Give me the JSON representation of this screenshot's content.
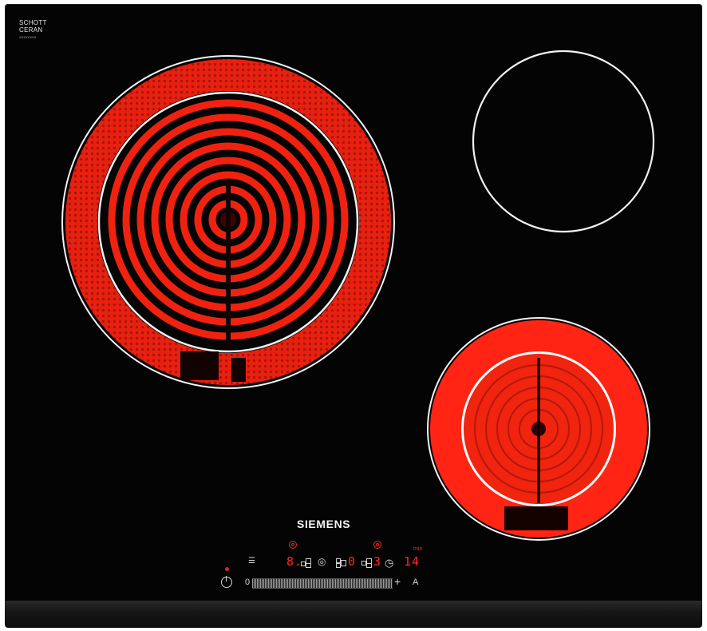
{
  "brand_mark": {
    "line1": "SCHOTT",
    "line2": "CERAN",
    "line3": "XXXXXXXX"
  },
  "brand": "SIEMENS",
  "zones": [
    {
      "id": "front-left",
      "state": "glowing",
      "rings": 2
    },
    {
      "id": "rear-right",
      "state": "off"
    },
    {
      "id": "front-right",
      "state": "glowing",
      "rings": 2
    }
  ],
  "controls": {
    "power_icon": "power-icon",
    "slider_min": "0",
    "slider_max": "+",
    "auto_label": "A",
    "display_left": "8.",
    "display_mid": "0",
    "display_zone": "3",
    "timer_value": "14",
    "timer_unit": "min"
  },
  "colors": {
    "glass": "#040404",
    "heat": "#ff2a1a",
    "outline": "#ffffff",
    "display": "#ff2a1a"
  }
}
